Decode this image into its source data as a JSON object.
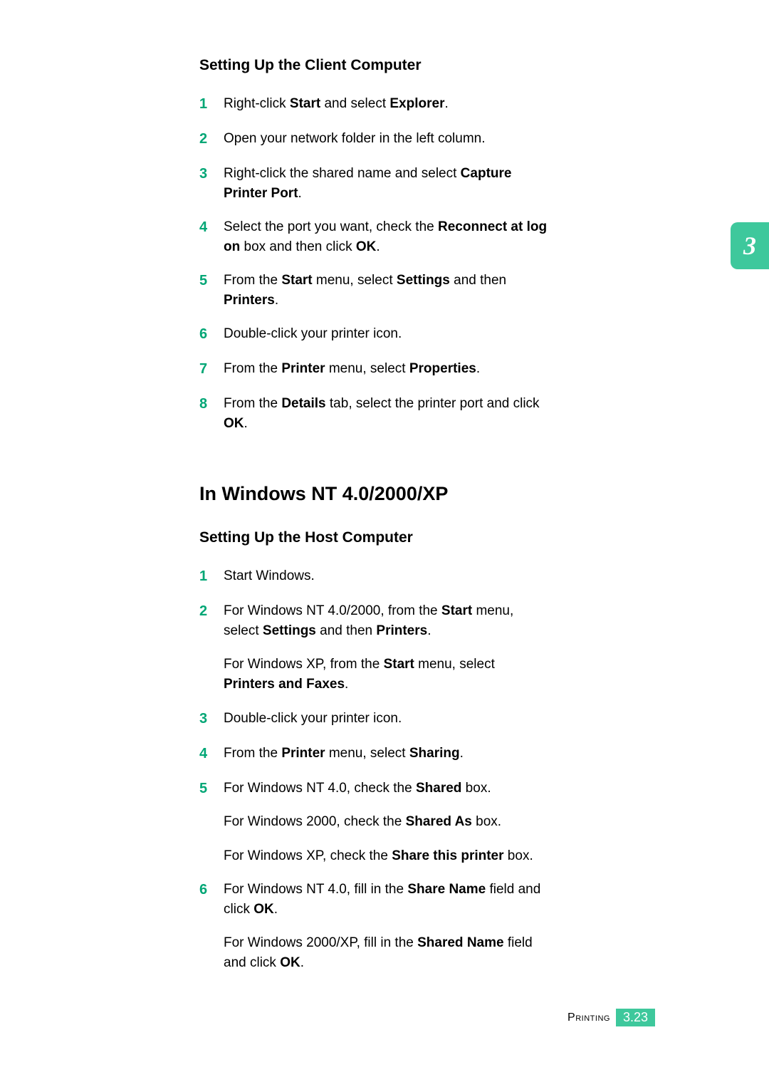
{
  "chapterTab": "3",
  "footer": {
    "label": "Printing",
    "page": "3.23"
  },
  "section1": {
    "title": "Setting Up the Client Computer",
    "steps": [
      {
        "n": "1",
        "parts": [
          [
            {
              "t": "Right-click "
            },
            {
              "t": "Start",
              "b": true
            },
            {
              "t": " and select "
            },
            {
              "t": "Explorer",
              "b": true
            },
            {
              "t": "."
            }
          ]
        ]
      },
      {
        "n": "2",
        "parts": [
          [
            {
              "t": "Open your network folder in the left column."
            }
          ]
        ]
      },
      {
        "n": "3",
        "parts": [
          [
            {
              "t": "Right-click the shared name and select "
            },
            {
              "t": "Capture Printer Port",
              "b": true
            },
            {
              "t": "."
            }
          ]
        ]
      },
      {
        "n": "4",
        "parts": [
          [
            {
              "t": "Select the port you want, check the "
            },
            {
              "t": "Reconnect at log on",
              "b": true
            },
            {
              "t": " box and then click "
            },
            {
              "t": "OK",
              "b": true
            },
            {
              "t": "."
            }
          ]
        ]
      },
      {
        "n": "5",
        "parts": [
          [
            {
              "t": "From the "
            },
            {
              "t": "Start",
              "b": true
            },
            {
              "t": " menu, select "
            },
            {
              "t": "Settings",
              "b": true
            },
            {
              "t": " and then "
            },
            {
              "t": "Printers",
              "b": true
            },
            {
              "t": "."
            }
          ]
        ]
      },
      {
        "n": "6",
        "parts": [
          [
            {
              "t": "Double-click your printer icon."
            }
          ]
        ]
      },
      {
        "n": "7",
        "parts": [
          [
            {
              "t": "From the "
            },
            {
              "t": "Printer",
              "b": true
            },
            {
              "t": " menu, select "
            },
            {
              "t": "Properties",
              "b": true
            },
            {
              "t": "."
            }
          ]
        ]
      },
      {
        "n": "8",
        "parts": [
          [
            {
              "t": "From the "
            },
            {
              "t": "Details",
              "b": true
            },
            {
              "t": " tab, select the printer port and click "
            },
            {
              "t": "OK",
              "b": true
            },
            {
              "t": "."
            }
          ]
        ]
      }
    ]
  },
  "heading2": "In Windows NT 4.0/2000/XP",
  "section2": {
    "title": "Setting Up the Host Computer",
    "steps": [
      {
        "n": "1",
        "parts": [
          [
            {
              "t": "Start Windows."
            }
          ]
        ]
      },
      {
        "n": "2",
        "parts": [
          [
            {
              "t": "For Windows NT 4.0/2000, from the "
            },
            {
              "t": "Start",
              "b": true
            },
            {
              "t": " menu, select "
            },
            {
              "t": "Settings",
              "b": true
            },
            {
              "t": " and then "
            },
            {
              "t": "Printers",
              "b": true
            },
            {
              "t": "."
            }
          ],
          [
            {
              "t": "For Windows XP, from the "
            },
            {
              "t": "Start",
              "b": true
            },
            {
              "t": " menu, select "
            },
            {
              "t": "Printers and Faxes",
              "b": true
            },
            {
              "t": "."
            }
          ]
        ]
      },
      {
        "n": "3",
        "parts": [
          [
            {
              "t": "Double-click your printer icon."
            }
          ]
        ]
      },
      {
        "n": "4",
        "parts": [
          [
            {
              "t": "From the "
            },
            {
              "t": "Printer",
              "b": true
            },
            {
              "t": " menu, select "
            },
            {
              "t": "Sharing",
              "b": true
            },
            {
              "t": "."
            }
          ]
        ]
      },
      {
        "n": "5",
        "parts": [
          [
            {
              "t": "For Windows NT 4.0, check the "
            },
            {
              "t": "Shared",
              "b": true
            },
            {
              "t": " box."
            }
          ],
          [
            {
              "t": "For Windows 2000, check the "
            },
            {
              "t": "Shared As",
              "b": true
            },
            {
              "t": " box."
            }
          ],
          [
            {
              "t": "For Windows XP, check the "
            },
            {
              "t": "Share this printer",
              "b": true
            },
            {
              "t": " box."
            }
          ]
        ]
      },
      {
        "n": "6",
        "parts": [
          [
            {
              "t": "For Windows NT 4.0, fill in the "
            },
            {
              "t": "Share Name",
              "b": true
            },
            {
              "t": " field and click "
            },
            {
              "t": "OK",
              "b": true
            },
            {
              "t": "."
            }
          ],
          [
            {
              "t": "For Windows 2000/XP, fill in the "
            },
            {
              "t": "Shared Name",
              "b": true
            },
            {
              "t": " field and click "
            },
            {
              "t": "OK",
              "b": true
            },
            {
              "t": "."
            }
          ]
        ]
      }
    ]
  }
}
